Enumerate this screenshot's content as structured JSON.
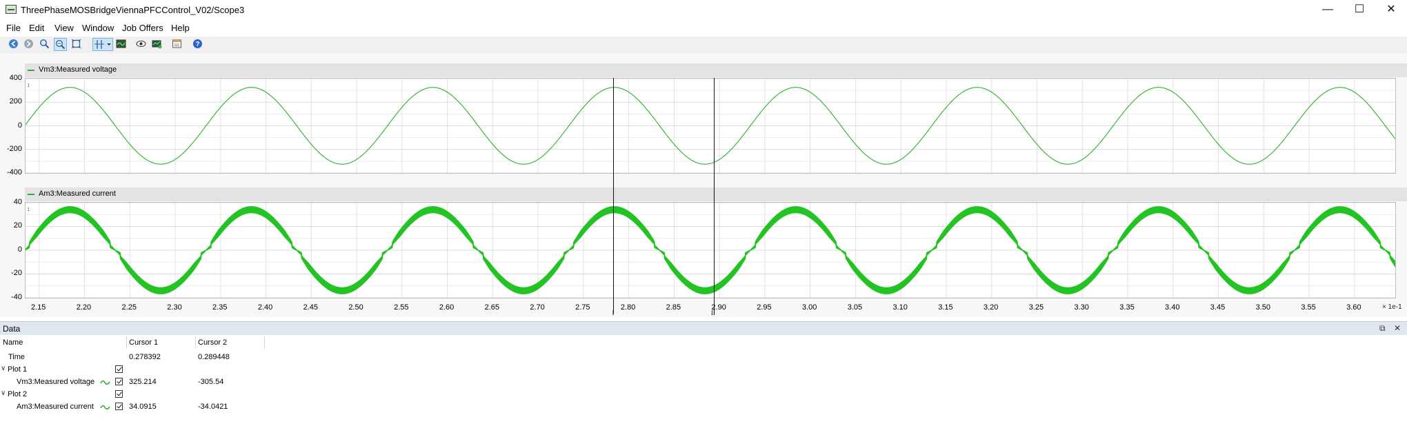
{
  "window": {
    "title": "ThreePhaseMOSBridgeViennaPFCControl_V02/Scope3",
    "controls": [
      "minimize-icon",
      "maximize-icon",
      "close-icon"
    ]
  },
  "menu": [
    "File",
    "Edit",
    "View",
    "Window",
    "Job Offers",
    "Help"
  ],
  "toolbar": {
    "icons": [
      "back-icon",
      "forward-icon",
      "zoom-icon",
      "zoom-area-icon",
      "zoom-fit-icon",
      "cursor-icon",
      "dropdown-icon",
      "scope-icon",
      "view-icon",
      "export-icon",
      "properties-icon",
      "help-icon"
    ]
  },
  "colors": {
    "signal": "#2fae2f",
    "signal_thick": "#22c322",
    "cursor": "#111111"
  },
  "cursors": {
    "t1": 0.278392,
    "t2": 0.289448,
    "label1": "I",
    "label2": "II"
  },
  "x_axis": {
    "ticks": [
      "2.15",
      "2.20",
      "2.25",
      "2.30",
      "2.35",
      "2.40",
      "2.45",
      "2.50",
      "2.55",
      "2.60",
      "2.65",
      "2.70",
      "2.75",
      "2.80",
      "2.85",
      "2.90",
      "2.95",
      "3.00",
      "3.05",
      "3.10",
      "3.15",
      "3.20",
      "3.25",
      "3.30",
      "3.35",
      "3.40",
      "3.45",
      "3.50",
      "3.55",
      "3.60"
    ],
    "exponent": "× 1e-1"
  },
  "plots": [
    {
      "title": "Vm3:Measured voltage",
      "yticks": [
        "400",
        "200",
        "0",
        "-200",
        "-400"
      ]
    },
    {
      "title": "Am3:Measured current",
      "yticks": [
        "40",
        "20",
        "0",
        "-20",
        "-40"
      ]
    }
  ],
  "chart_data": [
    {
      "type": "line",
      "title": "Vm3:Measured voltage",
      "xlabel": "",
      "ylabel": "",
      "x_unit_scale": "× 1e-1",
      "xlim": [
        0.2135,
        0.3645
      ],
      "ylim": [
        -400,
        400
      ],
      "series": [
        {
          "name": "Vm3:Measured voltage",
          "frequency_hz": 50,
          "amplitude": 325.2,
          "peak_time": 0.2784,
          "values_at": [
            [
              0.2784,
              325.214
            ],
            [
              0.2894,
              -305.54
            ]
          ]
        }
      ]
    },
    {
      "type": "line",
      "title": "Am3:Measured current",
      "xlabel": "",
      "ylabel": "",
      "x_unit_scale": "× 1e-1",
      "xlim": [
        0.2135,
        0.3645
      ],
      "ylim": [
        -40,
        40
      ],
      "series": [
        {
          "name": "Am3:Measured current",
          "frequency_hz": 50,
          "amplitude": 34.1,
          "ripple": 2.5,
          "peak_time": 0.2784,
          "values_at": [
            [
              0.2784,
              34.0915
            ],
            [
              0.2894,
              -34.0421
            ]
          ]
        }
      ]
    }
  ],
  "data_panel": {
    "title": "Data",
    "columns": [
      "Name",
      "Cursor 1",
      "Cursor 2"
    ],
    "time_row": {
      "label": "Time",
      "c1": "0.278392",
      "c2": "0.289448"
    },
    "groups": [
      {
        "label": "Plot 1",
        "signal": "Vm3:Measured voltage",
        "c1": "325.214",
        "c2": "-305.54"
      },
      {
        "label": "Plot 2",
        "signal": "Am3:Measured current",
        "c1": "34.0915",
        "c2": "-34.0421"
      }
    ]
  }
}
